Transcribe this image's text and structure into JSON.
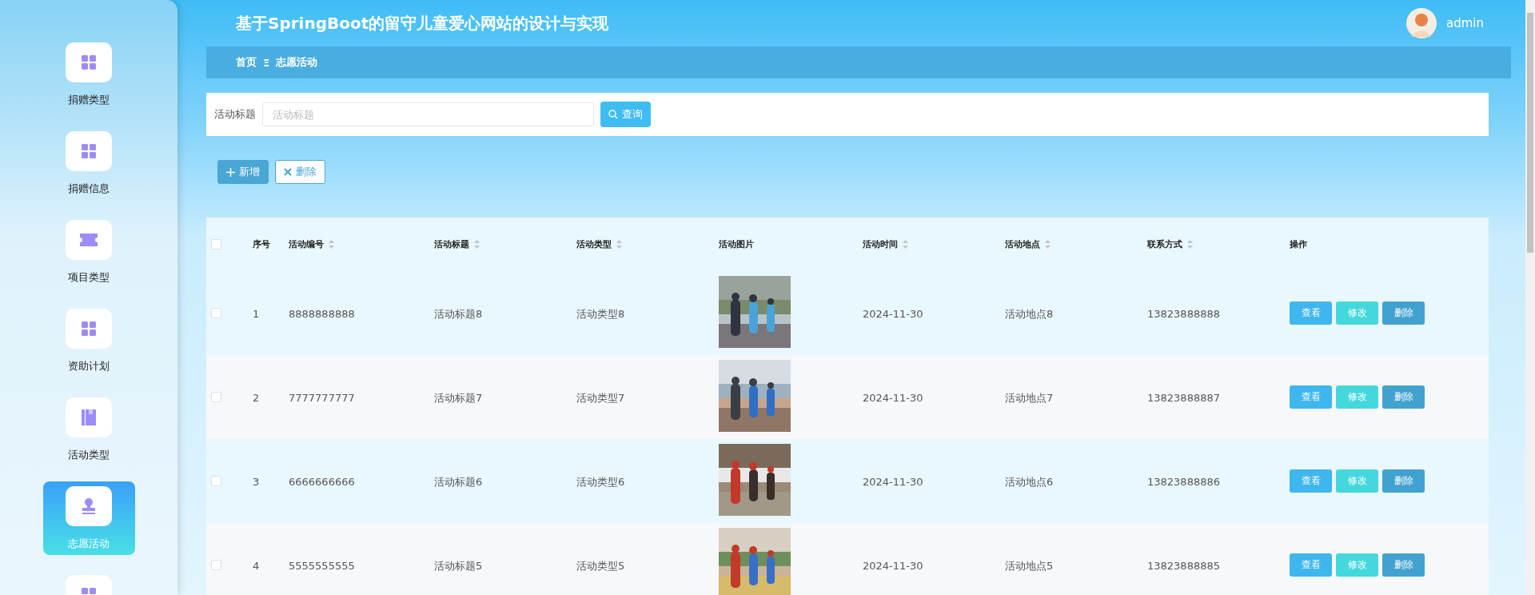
{
  "header": {
    "title": "基于SpringBoot的留守儿童爱心网站的设计与实现",
    "user": "admin"
  },
  "sidebar": {
    "items": [
      {
        "label": "捐赠类型",
        "kind": "grid",
        "selected": false
      },
      {
        "label": "捐赠信息",
        "kind": "grid",
        "selected": false
      },
      {
        "label": "项目类型",
        "kind": "ticket",
        "selected": false
      },
      {
        "label": "资助计划",
        "kind": "grid",
        "selected": false
      },
      {
        "label": "活动类型",
        "kind": "book",
        "selected": false
      },
      {
        "label": "志愿活动",
        "kind": "stamp",
        "selected": true
      },
      {
        "kind": "grid",
        "selected": false
      }
    ]
  },
  "breadcrumb": {
    "items": [
      "首页",
      "志愿活动"
    ],
    "separator": "Ξ"
  },
  "search": {
    "label": "活动标题",
    "placeholder": "活动标题",
    "button": "查询"
  },
  "actions": [
    {
      "label": "新增",
      "kind": "add"
    },
    {
      "label": "删除",
      "kind": "delete"
    }
  ],
  "table": {
    "all_checked": false,
    "columns": [
      {
        "label": "序号",
        "sortable": false
      },
      {
        "label": "活动编号",
        "sortable": true
      },
      {
        "label": "活动标题",
        "sortable": true
      },
      {
        "label": "活动类型",
        "sortable": true
      },
      {
        "label": "活动图片",
        "sortable": false
      },
      {
        "label": "活动时间",
        "sortable": true
      },
      {
        "label": "活动地点",
        "sortable": true
      },
      {
        "label": "联系方式",
        "sortable": true
      },
      {
        "label": "操作",
        "sortable": false
      }
    ],
    "rows": [
      {
        "checked": false,
        "cells": [
          {
            "kind": "text",
            "text": "1"
          },
          {
            "kind": "text",
            "text": "8888888888"
          },
          {
            "kind": "text",
            "text": "活动标题8"
          },
          {
            "kind": "text",
            "text": "活动类型8"
          },
          {
            "kind": "picture"
          },
          {
            "kind": "text",
            "text": "2024-11-30"
          },
          {
            "kind": "text",
            "text": "活动地点8"
          },
          {
            "kind": "text",
            "text": "13823888888"
          },
          {
            "kind": "buttons",
            "buttons": [
              "查看",
              "修改",
              "删除"
            ]
          }
        ]
      },
      {
        "checked": false,
        "cells": [
          {
            "kind": "text",
            "text": "2"
          },
          {
            "kind": "text",
            "text": "7777777777"
          },
          {
            "kind": "text",
            "text": "活动标题7"
          },
          {
            "kind": "text",
            "text": "活动类型7"
          },
          {
            "kind": "picture"
          },
          {
            "kind": "text",
            "text": "2024-11-30"
          },
          {
            "kind": "text",
            "text": "活动地点7"
          },
          {
            "kind": "text",
            "text": "13823888887"
          },
          {
            "kind": "buttons",
            "buttons": [
              "查看",
              "修改",
              "删除"
            ]
          }
        ]
      },
      {
        "checked": false,
        "cells": [
          {
            "kind": "text",
            "text": "3"
          },
          {
            "kind": "text",
            "text": "6666666666"
          },
          {
            "kind": "text",
            "text": "活动标题6"
          },
          {
            "kind": "text",
            "text": "活动类型6"
          },
          {
            "kind": "picture"
          },
          {
            "kind": "text",
            "text": "2024-11-30"
          },
          {
            "kind": "text",
            "text": "活动地点6"
          },
          {
            "kind": "text",
            "text": "13823888886"
          },
          {
            "kind": "buttons",
            "buttons": [
              "查看",
              "修改",
              "删除"
            ]
          }
        ]
      },
      {
        "checked": false,
        "cells": [
          {
            "kind": "text",
            "text": "4"
          },
          {
            "kind": "text",
            "text": "5555555555"
          },
          {
            "kind": "text",
            "text": "活动标题5"
          },
          {
            "kind": "text",
            "text": "活动类型5"
          },
          {
            "kind": "picture"
          },
          {
            "kind": "text",
            "text": "2024-11-30"
          },
          {
            "kind": "text",
            "text": "活动地点5"
          },
          {
            "kind": "text",
            "text": "13823888885"
          },
          {
            "kind": "buttons",
            "buttons": [
              "查看",
              "修改",
              "删除"
            ]
          }
        ]
      }
    ]
  }
}
